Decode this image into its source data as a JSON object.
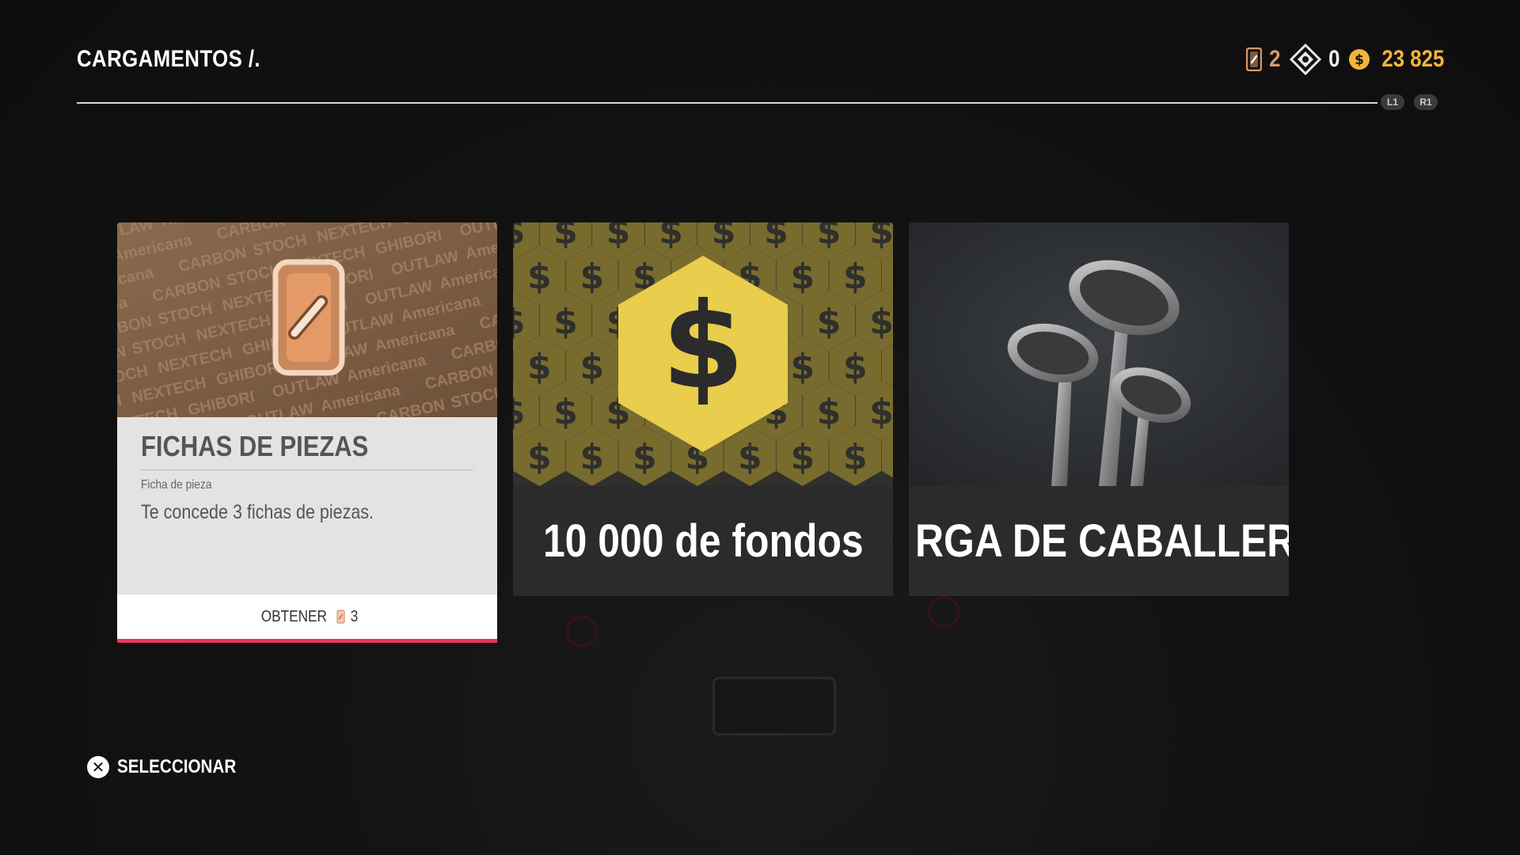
{
  "header": {
    "title": "CARGAMENTOS /.",
    "shoulder_left": "L1",
    "shoulder_right": "R1"
  },
  "currency": {
    "part_tokens": "2",
    "tokens": "0",
    "funds": "23 825",
    "colors": {
      "part_tokens": "#d8966a",
      "funds": "#f2b33d"
    },
    "icons": [
      "part-token-icon",
      "diamond-token-icon",
      "funds-coin-icon"
    ]
  },
  "cards": [
    {
      "title": "FICHAS DE PIEZAS",
      "subtitle": "Ficha de pieza",
      "description": "Te concede 3 fichas de piezas.",
      "button_label": "OBTENER",
      "button_cost": "3",
      "image_words": [
        "GHIBORI",
        "OUTLAW",
        "Americana",
        "CARBON",
        "STOCH",
        "NEXTECH"
      ],
      "accent": "#e8365d"
    },
    {
      "caption": "10 000 de fondos",
      "icon": "funds-hexagon-icon"
    },
    {
      "caption": "RGA DE CABALLERÍA",
      "icon": "horn-icon"
    }
  ],
  "footer": {
    "select_label": "SELECCIONAR"
  }
}
